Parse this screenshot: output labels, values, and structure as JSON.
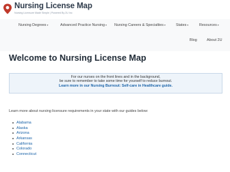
{
  "header": {
    "title": "Nursing License Map",
    "tagline": "Nursing Licensure Made Simple | Powered By 2U Inc"
  },
  "nav": {
    "items": [
      {
        "label": "Nursing Degrees",
        "has_dropdown": true
      },
      {
        "label": "Advanced Practice Nursing",
        "has_dropdown": true
      },
      {
        "label": "Nursing Careers & Specialties",
        "has_dropdown": true
      },
      {
        "label": "States",
        "has_dropdown": true
      },
      {
        "label": "Resources",
        "has_dropdown": true
      },
      {
        "label": "Blog",
        "has_dropdown": false
      },
      {
        "label": "About 2U",
        "has_dropdown": false
      }
    ]
  },
  "hero": {
    "heading": "Welcome to Nursing License Map"
  },
  "notice": {
    "line1": "For our nurses on the front lines and in the background,",
    "line2": "be sure to remember to take some time for yourself to reduce burnout.",
    "link_text": "Learn more in our Nursing Burnout: Self-care in Healthcare guide."
  },
  "main": {
    "intro": "Learn more about nursing licensure requirements in your state with our guides below:",
    "states": [
      "Alabama",
      "Alaska",
      "Arizona",
      "Arkansas",
      "California",
      "Colorado",
      "Connecticut"
    ]
  },
  "colors": {
    "accent": "#c0392b",
    "link": "#1a63a8",
    "nav_bg": "#f8f9fa",
    "notice_bg": "#eef4fa"
  }
}
